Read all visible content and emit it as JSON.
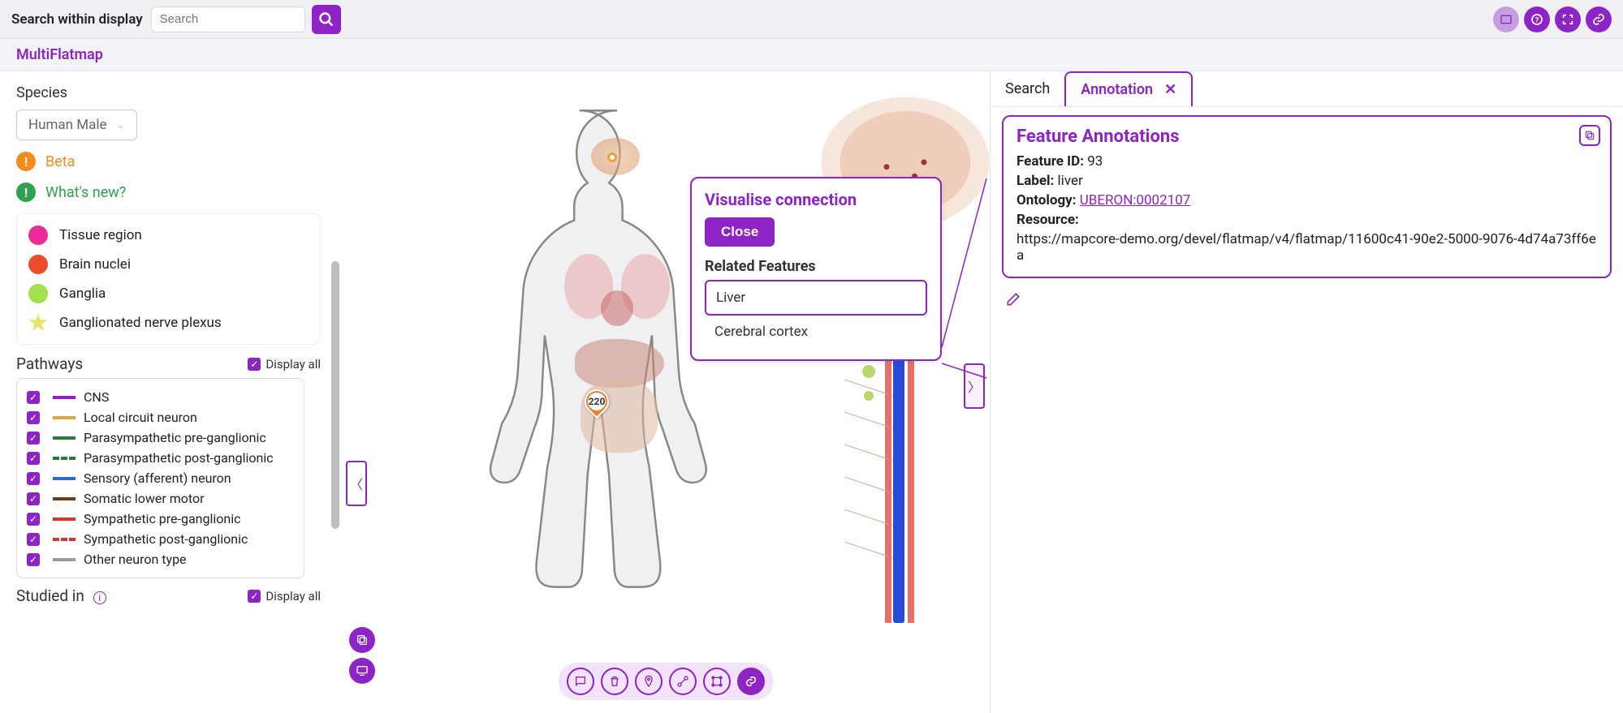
{
  "topbar": {
    "search_label": "Search within display",
    "search_placeholder": "Search"
  },
  "subheader": {
    "title": "MultiFlatmap"
  },
  "sidebar": {
    "species_label": "Species",
    "species_value": "Human Male",
    "beta_label": "Beta",
    "whatsnew_label": "What's new?",
    "legend": [
      {
        "color": "#ec2c97",
        "label": "Tissue region"
      },
      {
        "color": "#ee4a2c",
        "label": "Brain nuclei"
      },
      {
        "color": "#a2e04e",
        "label": "Ganglia"
      },
      {
        "shape": "star",
        "label": "Ganglionated nerve plexus"
      }
    ],
    "pathways_label": "Pathways",
    "display_all_label": "Display all",
    "pathways": [
      {
        "color": "#8e24c5",
        "dashed": false,
        "label": "CNS"
      },
      {
        "color": "#e8a23a",
        "dashed": false,
        "label": "Local circuit neuron"
      },
      {
        "color": "#2b7a3a",
        "dashed": false,
        "label": "Parasympathetic pre-ganglionic"
      },
      {
        "color": "#2b7a3a",
        "dashed": true,
        "label": "Parasympathetic post-ganglionic"
      },
      {
        "color": "#2a6bd8",
        "dashed": false,
        "label": "Sensory (afferent) neuron"
      },
      {
        "color": "#6b3f1e",
        "dashed": false,
        "label": "Somatic lower motor"
      },
      {
        "color": "#d8342f",
        "dashed": false,
        "label": "Sympathetic pre-ganglionic"
      },
      {
        "color": "#d8342f",
        "dashed": true,
        "label": "Sympathetic post-ganglionic"
      },
      {
        "color": "#9a9a9a",
        "dashed": false,
        "label": "Other neuron type"
      }
    ],
    "studied_label": "Studied in"
  },
  "canvas": {
    "marker_value": "220",
    "popup": {
      "title": "Visualise connection",
      "close_label": "Close",
      "related_title": "Related Features",
      "items": [
        "Liver",
        "Cerebral cortex"
      ]
    }
  },
  "right_panel": {
    "tabs": [
      "Search",
      "Annotation"
    ],
    "active_tab": 1,
    "anno": {
      "title": "Feature Annotations",
      "feature_id_label": "Feature ID:",
      "feature_id": "93",
      "label_label": "Label:",
      "label": "liver",
      "ontology_label": "Ontology:",
      "ontology": "UBERON:0002107",
      "resource_label": "Resource:",
      "resource": "https://mapcore-demo.org/devel/flatmap/v4/flatmap/11600c41-90e2-5000-9076-4d74a73ff6ea"
    }
  }
}
